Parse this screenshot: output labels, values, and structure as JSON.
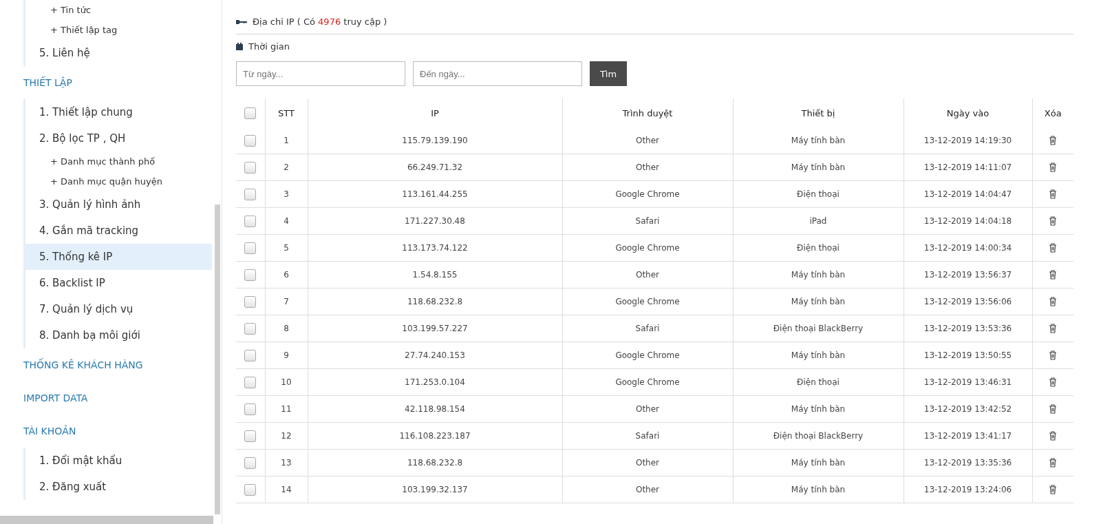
{
  "sidebar": {
    "sections": [
      {
        "items": [
          {
            "label": "+ Tin tức",
            "kind": "sub",
            "selected": false
          },
          {
            "label": "+ Thiết lập tag",
            "kind": "sub",
            "selected": false
          },
          {
            "label": "5. Liên hệ",
            "kind": "item",
            "selected": false
          }
        ]
      },
      {
        "heading": "THIẾT LẬP",
        "items": [
          {
            "label": "1. Thiết lập chung",
            "kind": "item",
            "selected": false
          },
          {
            "label": "2. Bộ lọc TP , QH",
            "kind": "item",
            "selected": false
          },
          {
            "label": "+ Danh mục thành phố",
            "kind": "sub",
            "selected": false
          },
          {
            "label": "+ Danh mục quận huyện",
            "kind": "sub",
            "selected": false
          },
          {
            "label": "3. Quản lý hình ảnh",
            "kind": "item",
            "selected": false
          },
          {
            "label": "4. Gắn mã tracking",
            "kind": "item",
            "selected": false
          },
          {
            "label": "5. Thống kê IP",
            "kind": "item",
            "selected": true
          },
          {
            "label": "6. Backlist IP",
            "kind": "item",
            "selected": false
          },
          {
            "label": "7. Quản lý dịch vụ",
            "kind": "item",
            "selected": false
          },
          {
            "label": "8. Danh bạ môi giới",
            "kind": "item",
            "selected": false
          }
        ]
      },
      {
        "heading": "THỐNG KÊ KHÁCH HÀNG"
      },
      {
        "heading": "IMPORT DATA"
      },
      {
        "heading": "TÀI KHOẢN",
        "items": [
          {
            "label": "1. Đổi mật khẩu",
            "kind": "item",
            "selected": false
          },
          {
            "label": "2. Đăng xuất",
            "kind": "item",
            "selected": false
          }
        ]
      }
    ]
  },
  "title": {
    "before": "Địa chỉ IP ( Có",
    "count": "4976",
    "after": "truy cập )"
  },
  "filter": {
    "label": "Thời gian",
    "from_placeholder": "Từ ngày...",
    "to_placeholder": "Đến ngày...",
    "button": "Tìm"
  },
  "table": {
    "select_all_checked": false,
    "columns": [
      "STT",
      "IP",
      "Trình duyệt",
      "Thiết bị",
      "Ngày vào",
      "Xóa"
    ],
    "rows": [
      {
        "checked": false,
        "cells": [
          "1",
          "115.79.139.190",
          "Other",
          "Máy tính bàn",
          "13-12-2019 14:19:30"
        ]
      },
      {
        "checked": false,
        "cells": [
          "2",
          "66.249.71.32",
          "Other",
          "Máy tính bàn",
          "13-12-2019 14:11:07"
        ]
      },
      {
        "checked": false,
        "cells": [
          "3",
          "113.161.44.255",
          "Google Chrome",
          "Điện thoại",
          "13-12-2019 14:04:47"
        ]
      },
      {
        "checked": false,
        "cells": [
          "4",
          "171.227.30.48",
          "Safari",
          "iPad",
          "13-12-2019 14:04:18"
        ]
      },
      {
        "checked": false,
        "cells": [
          "5",
          "113.173.74.122",
          "Google Chrome",
          "Điện thoại",
          "13-12-2019 14:00:34"
        ]
      },
      {
        "checked": false,
        "cells": [
          "6",
          "1.54.8.155",
          "Other",
          "Máy tính bàn",
          "13-12-2019 13:56:37"
        ]
      },
      {
        "checked": false,
        "cells": [
          "7",
          "118.68.232.8",
          "Google Chrome",
          "Máy tính bàn",
          "13-12-2019 13:56:06"
        ]
      },
      {
        "checked": false,
        "cells": [
          "8",
          "103.199.57.227",
          "Safari",
          "Điện thoại BlackBerry",
          "13-12-2019 13:53:36"
        ]
      },
      {
        "checked": false,
        "cells": [
          "9",
          "27.74.240.153",
          "Google Chrome",
          "Máy tính bàn",
          "13-12-2019 13:50:55"
        ]
      },
      {
        "checked": false,
        "cells": [
          "10",
          "171.253.0.104",
          "Google Chrome",
          "Điện thoại",
          "13-12-2019 13:46:31"
        ]
      },
      {
        "checked": false,
        "cells": [
          "11",
          "42.118.98.154",
          "Other",
          "Máy tính bàn",
          "13-12-2019 13:42:52"
        ]
      },
      {
        "checked": false,
        "cells": [
          "12",
          "116.108.223.187",
          "Safari",
          "Điện thoại BlackBerry",
          "13-12-2019 13:41:17"
        ]
      },
      {
        "checked": false,
        "cells": [
          "13",
          "118.68.232.8",
          "Other",
          "Máy tính bàn",
          "13-12-2019 13:35:36"
        ]
      },
      {
        "checked": false,
        "cells": [
          "14",
          "103.199.32.137",
          "Other",
          "Máy tính bàn",
          "13-12-2019 13:24:06"
        ]
      }
    ]
  }
}
